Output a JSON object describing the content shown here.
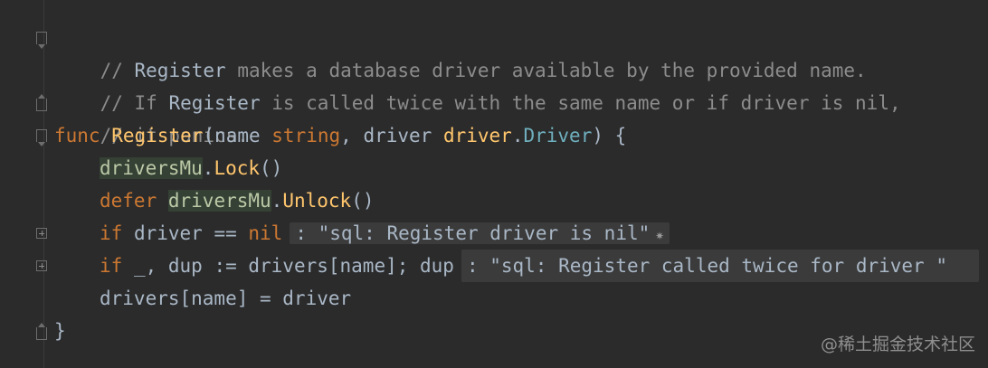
{
  "code_lines": {
    "l1": {
      "c1": "// ",
      "c2": "Register",
      "c3": " makes a database driver available by the provided name."
    },
    "l2": {
      "c1": "// If ",
      "c2": "Register",
      "c3": " is called twice with the same name or if driver is nil,"
    },
    "l3": {
      "c1": "// it panics."
    },
    "l4": {
      "kw_func": "func",
      "fn_name": "Register",
      "p_open": "(",
      "param1": "name",
      "type_string": "string",
      "comma": ",",
      "param2": "driver",
      "pkg": "driver",
      "dot": ".",
      "type_driver": "Driver",
      "p_close": ") {"
    },
    "l5": {
      "mutex": "driversMu",
      "dot": ".",
      "method": "Lock",
      "call": "()"
    },
    "l6": {
      "kw_defer": "defer",
      "mutex": "driversMu",
      "dot": ".",
      "method": "Unlock",
      "call": "()"
    },
    "l7": {
      "kw_if": "if",
      "expr": " driver == ",
      "kw_nil": "nil",
      "hint": ": \"sql: Register driver is nil\""
    },
    "l8": {
      "kw_if": "if",
      "expr": " _, dup := drivers[name]; dup",
      "hint": ": \"sql: Register called twice for driver \""
    },
    "l9": {
      "stmt": "drivers[name] = driver"
    },
    "l10": {
      "close": "}"
    }
  },
  "watermark": "@稀土掘金技术社区",
  "colors": {
    "background": "#2b2b2b",
    "comment": "#8c8c8c",
    "keyword": "#cc7832",
    "function": "#ffc66d",
    "type_name": "#6fafbd",
    "text": "#a9b7c6",
    "highlight": "#344134",
    "inlay_hint_bg": "#3b3b3b"
  },
  "icons": {
    "fold_open": "fold-open-icon",
    "fold_end": "fold-end-icon",
    "fold_collapsed": "fold-expand-icon",
    "hint_marker": "sparkle-icon"
  }
}
